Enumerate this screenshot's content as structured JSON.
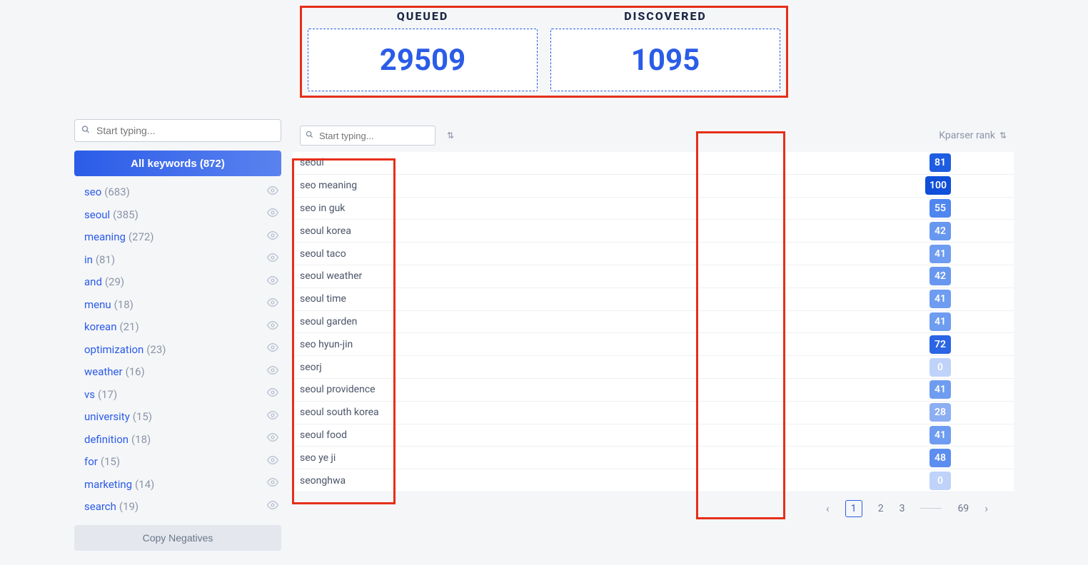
{
  "stats": {
    "queued": {
      "label": "QUEUED",
      "value": "29509"
    },
    "discovered": {
      "label": "DISCOVERED",
      "value": "1095"
    }
  },
  "sidebar": {
    "search_placeholder": "Start typing...",
    "all_keywords_label": "All keywords (872)",
    "copy_negatives_label": "Copy Negatives",
    "items": [
      {
        "word": "seo",
        "count": "(683)"
      },
      {
        "word": "seoul",
        "count": "(385)"
      },
      {
        "word": "meaning",
        "count": "(272)"
      },
      {
        "word": "in",
        "count": "(81)"
      },
      {
        "word": "and",
        "count": "(29)"
      },
      {
        "word": "menu",
        "count": "(18)"
      },
      {
        "word": "korean",
        "count": "(21)"
      },
      {
        "word": "optimization",
        "count": "(23)"
      },
      {
        "word": "weather",
        "count": "(16)"
      },
      {
        "word": "vs",
        "count": "(17)"
      },
      {
        "word": "university",
        "count": "(15)"
      },
      {
        "word": "definition",
        "count": "(18)"
      },
      {
        "word": "for",
        "count": "(15)"
      },
      {
        "word": "marketing",
        "count": "(14)"
      },
      {
        "word": "search",
        "count": "(19)"
      }
    ]
  },
  "table": {
    "search_placeholder": "Start typing...",
    "rank_header": "Kparser rank",
    "rows": [
      {
        "keyword": "seoul",
        "rank": "81",
        "color": "#1e5de2"
      },
      {
        "keyword": "seo meaning",
        "rank": "100",
        "color": "#0f4fd9"
      },
      {
        "keyword": "seo in guk",
        "rank": "55",
        "color": "#4f86ef"
      },
      {
        "keyword": "seoul korea",
        "rank": "42",
        "color": "#6897f0"
      },
      {
        "keyword": "seoul taco",
        "rank": "41",
        "color": "#6e9cf1"
      },
      {
        "keyword": "seoul weather",
        "rank": "42",
        "color": "#6897f0"
      },
      {
        "keyword": "seoul time",
        "rank": "41",
        "color": "#6e9cf1"
      },
      {
        "keyword": "seoul garden",
        "rank": "41",
        "color": "#6e9cf1"
      },
      {
        "keyword": "seo hyun-jin",
        "rank": "72",
        "color": "#2b64e4"
      },
      {
        "keyword": "seorj",
        "rank": "0",
        "color": "#bed2fa"
      },
      {
        "keyword": "seoul providence",
        "rank": "41",
        "color": "#6e9cf1"
      },
      {
        "keyword": "seoul south korea",
        "rank": "28",
        "color": "#8caef3"
      },
      {
        "keyword": "seoul food",
        "rank": "41",
        "color": "#6e9cf1"
      },
      {
        "keyword": "seo ye ji",
        "rank": "48",
        "color": "#5c8def"
      },
      {
        "keyword": "seonghwa",
        "rank": "0",
        "color": "#bed2fa"
      }
    ]
  },
  "pagination": {
    "pages": [
      "1",
      "2",
      "3"
    ],
    "last": "69"
  }
}
